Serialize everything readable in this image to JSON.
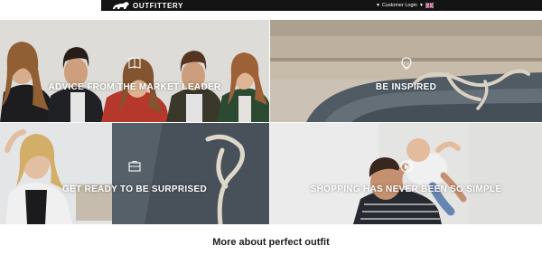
{
  "header": {
    "brand": "OUTFITTERY",
    "login_label": "Customer Login",
    "language": "UK flag"
  },
  "tiles": [
    {
      "label": "ADVICE FROM THE MARKET LEADER",
      "icon": "book-icon"
    },
    {
      "label": "BE INSPIRED",
      "icon": "lightbulb-icon"
    },
    {
      "label": "GET READY TO BE SURPRISED",
      "icon": "box-icon"
    },
    {
      "label": "SHOPPING HAS NEVER BEEN SO SIMPLE",
      "icon": "pointer-icon"
    }
  ],
  "section": {
    "heading": "More about perfect outfit"
  }
}
